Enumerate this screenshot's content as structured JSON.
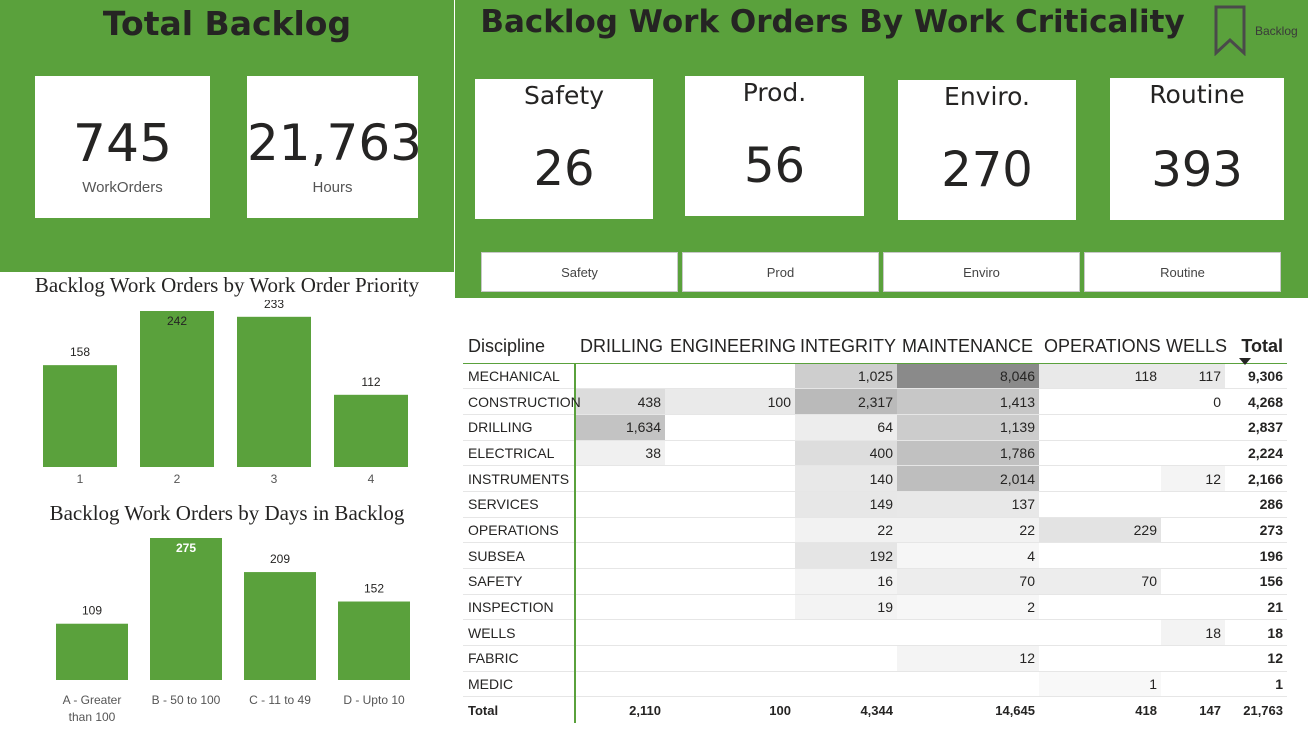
{
  "total_backlog": {
    "title": "Total Backlog",
    "cards": [
      {
        "value": "745",
        "label": "WorkOrders"
      },
      {
        "value": "21,763",
        "label": "Hours"
      }
    ]
  },
  "criticality": {
    "title": "Backlog Work Orders By Work Criticality",
    "bookmark_label": "Backlog",
    "cards": [
      {
        "label": "Safety",
        "value": "26"
      },
      {
        "label": "Prod.",
        "value": "56"
      },
      {
        "label": "Enviro.",
        "value": "270"
      },
      {
        "label": "Routine",
        "value": "393"
      }
    ],
    "slicer_buttons": [
      "Safety",
      "Prod",
      "Enviro",
      "Routine"
    ]
  },
  "colors": {
    "accent": "#5aa13c",
    "bar": "#5aa13c",
    "heat_dark": "#8a8a8a"
  },
  "chart_data": [
    {
      "type": "bar",
      "title": "Backlog Work Orders by Work Order Priority",
      "categories": [
        "1",
        "2",
        "3",
        "4"
      ],
      "values": [
        158,
        242,
        233,
        112
      ],
      "ylim": [
        0,
        242
      ]
    },
    {
      "type": "bar",
      "title": "Backlog Work Orders by Days in Backlog",
      "categories": [
        "A - Greater than 100",
        "B - 50 to 100",
        "C - 11 to 49",
        "D - Upto 10"
      ],
      "values": [
        109,
        275,
        209,
        152
      ],
      "ylim": [
        0,
        275
      ]
    }
  ],
  "matrix": {
    "row_header": "Discipline",
    "columns": [
      "DRILLING",
      "ENGINEERING",
      "INTEGRITY",
      "MAINTENANCE",
      "OPERATIONS",
      "WELLS",
      "Total"
    ],
    "rows": [
      {
        "name": "MECHANICAL",
        "cells": [
          "",
          "",
          "1,025",
          "8,046",
          "118",
          "117"
        ],
        "total": "9,306"
      },
      {
        "name": "CONSTRUCTION",
        "cells": [
          "438",
          "100",
          "2,317",
          "1,413",
          "",
          "0"
        ],
        "total": "4,268"
      },
      {
        "name": "DRILLING",
        "cells": [
          "1,634",
          "",
          "64",
          "1,139",
          "",
          ""
        ],
        "total": "2,837"
      },
      {
        "name": "ELECTRICAL",
        "cells": [
          "38",
          "",
          "400",
          "1,786",
          "",
          ""
        ],
        "total": "2,224"
      },
      {
        "name": "INSTRUMENTS",
        "cells": [
          "",
          "",
          "140",
          "2,014",
          "",
          "12"
        ],
        "total": "2,166"
      },
      {
        "name": "SERVICES",
        "cells": [
          "",
          "",
          "149",
          "137",
          "",
          ""
        ],
        "total": "286"
      },
      {
        "name": "OPERATIONS",
        "cells": [
          "",
          "",
          "22",
          "22",
          "229",
          ""
        ],
        "total": "273"
      },
      {
        "name": "SUBSEA",
        "cells": [
          "",
          "",
          "192",
          "4",
          "",
          ""
        ],
        "total": "196"
      },
      {
        "name": "SAFETY",
        "cells": [
          "",
          "",
          "16",
          "70",
          "70",
          ""
        ],
        "total": "156"
      },
      {
        "name": "INSPECTION",
        "cells": [
          "",
          "",
          "19",
          "2",
          "",
          ""
        ],
        "total": "21"
      },
      {
        "name": "WELLS",
        "cells": [
          "",
          "",
          "",
          "",
          "",
          "18"
        ],
        "total": "18"
      },
      {
        "name": "FABRIC",
        "cells": [
          "",
          "",
          "",
          "12",
          "",
          ""
        ],
        "total": "12"
      },
      {
        "name": "MEDIC",
        "cells": [
          "",
          "",
          "",
          "",
          "1",
          ""
        ],
        "total": "1"
      }
    ],
    "total_row": {
      "name": "Total",
      "cells": [
        "2,110",
        "100",
        "4,344",
        "14,645",
        "418",
        "147"
      ],
      "total": "21,763"
    }
  }
}
